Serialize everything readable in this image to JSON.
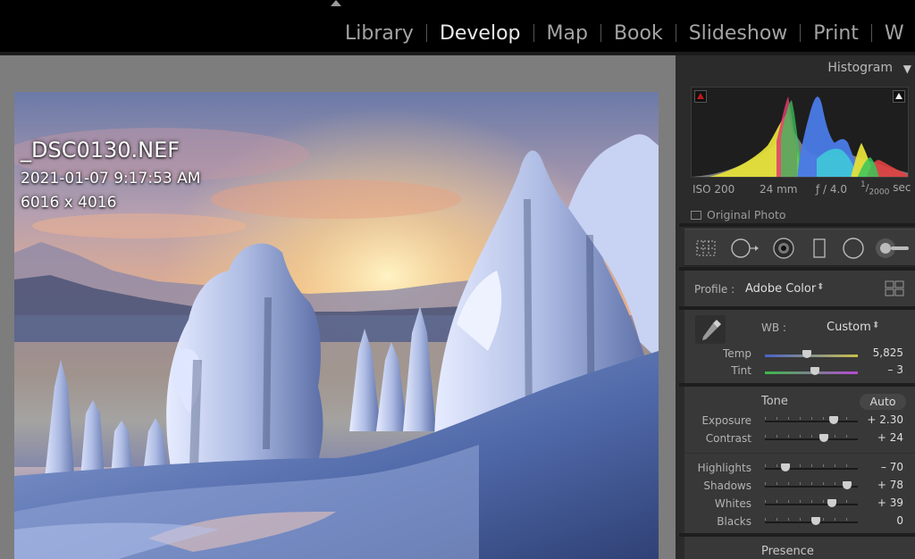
{
  "modules": [
    "Library",
    "Develop",
    "Map",
    "Book",
    "Slideshow",
    "Print",
    "W"
  ],
  "active_module": "Develop",
  "photo_info": {
    "filename": "_DSC0130.NEF",
    "datetime": "2021-01-07 9:17:53 AM",
    "dimensions": "6016 x 4016"
  },
  "histogram": {
    "title": "Histogram",
    "iso": "ISO 200",
    "focal_length": "24 mm",
    "aperture": "ƒ / 4.0",
    "shutter_num": "1",
    "shutter_den": "2000",
    "shutter_unit": "sec",
    "original_photo_label": "Original Photo"
  },
  "tools": [
    "crop-overlay",
    "spot-removal",
    "red-eye",
    "graduated-filter",
    "radial-filter",
    "adjustment-brush"
  ],
  "profile": {
    "label": "Profile :",
    "value": "Adobe Color",
    "arrows": "⬍"
  },
  "basic": {
    "wb_label": "WB :",
    "wb_value": "Custom",
    "wb_arrows": "⬍",
    "temp": {
      "label": "Temp",
      "value": "5,825",
      "position": 0.4
    },
    "tint": {
      "label": "Tint",
      "value": "– 3",
      "position": 0.49
    },
    "tone_label": "Tone",
    "auto_label": "Auto",
    "exposure": {
      "label": "Exposure",
      "value": "+ 2.30",
      "position": 0.69
    },
    "contrast": {
      "label": "Contrast",
      "value": "+ 24",
      "position": 0.59
    },
    "highlights": {
      "label": "Highlights",
      "value": "– 70",
      "position": 0.17
    },
    "shadows": {
      "label": "Shadows",
      "value": "+ 78",
      "position": 0.84
    },
    "whites": {
      "label": "Whites",
      "value": "+ 39",
      "position": 0.67
    },
    "blacks": {
      "label": "Blacks",
      "value": "0",
      "position": 0.5
    },
    "presence_label": "Presence"
  },
  "colors": {
    "active_module": "#eaeaea",
    "inactive_module": "#a3a3a3",
    "panel_bg": "#2b2b2b",
    "canvas_bg": "#7d7d7d",
    "shadow_clip": "#c01818",
    "highlight_clip": "#eeeeee"
  }
}
